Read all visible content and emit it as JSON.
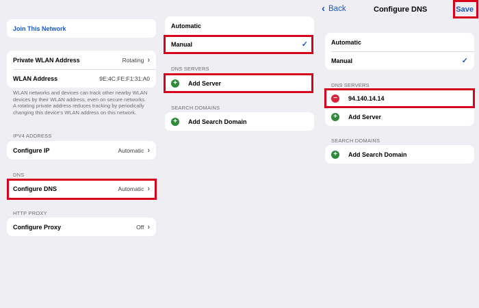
{
  "panel1": {
    "join_network": "Join This Network",
    "private_wlan_label": "Private WLAN Address",
    "private_wlan_value": "Rotating",
    "wlan_address_label": "WLAN Address",
    "wlan_address_value": "9E:4C:FE:F1:31:A0",
    "wlan_note": "WLAN networks and devices can track other nearby WLAN devices by their WLAN address, even on secure networks.\nA rotating private address reduces tracking by periodically changing this device's WLAN address on this network.",
    "ipv4_header": "IPV4 ADDRESS",
    "configure_ip_label": "Configure IP",
    "configure_ip_value": "Automatic",
    "dns_header": "DNS",
    "configure_dns_label": "Configure DNS",
    "configure_dns_value": "Automatic",
    "http_proxy_header": "HTTP PROXY",
    "configure_proxy_label": "Configure Proxy",
    "configure_proxy_value": "Off"
  },
  "panel2": {
    "automatic_label": "Automatic",
    "manual_label": "Manual",
    "dns_servers_header": "DNS SERVERS",
    "add_server_label": "Add Server",
    "search_domains_header": "SEARCH DOMAINS",
    "add_search_domain_label": "Add Search Domain"
  },
  "panel3": {
    "back_label": "Back",
    "title": "Configure DNS",
    "save_label": "Save",
    "automatic_label": "Automatic",
    "manual_label": "Manual",
    "dns_servers_header": "DNS SERVERS",
    "server_address": "94.140.14.14",
    "add_server_label": "Add Server",
    "search_domains_header": "SEARCH DOMAINS",
    "add_search_domain_label": "Add Search Domain"
  },
  "icons": {
    "chevron": "›",
    "chevron_left": "‹",
    "check": "✓",
    "plus": "+",
    "minus": "−"
  },
  "colors": {
    "background": "#efeef3",
    "accent": "#1a57c8",
    "highlight": "#d9001b",
    "add_green": "#2e8a3a",
    "remove_red": "#d8243b"
  }
}
